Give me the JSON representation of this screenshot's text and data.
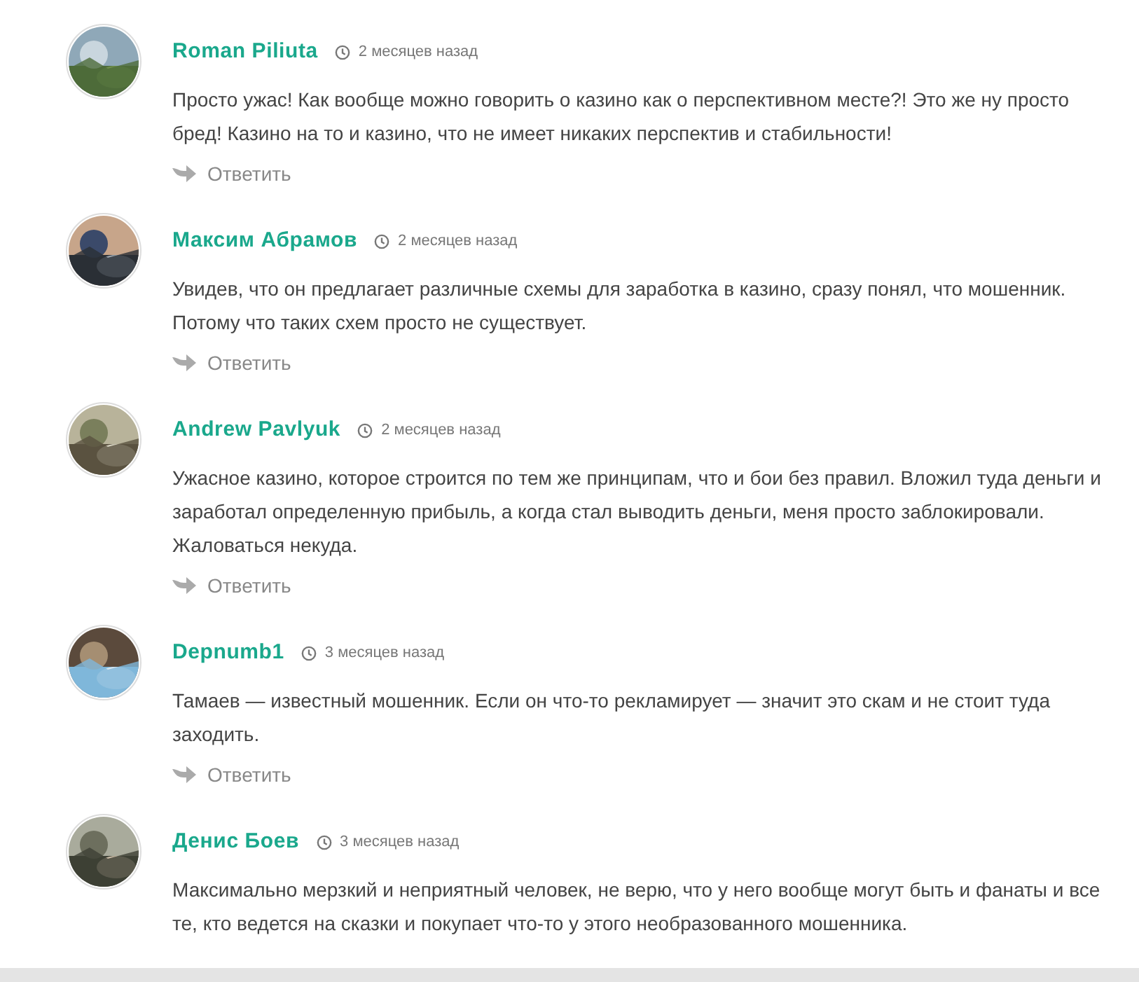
{
  "comments": [
    {
      "author": "Roman Piliuta",
      "time": "2 месяцев назад",
      "text": "Просто ужас! Как вообще можно говорить о казино как о перспективном месте?! Это же ну просто бред! Казино на то и казино, что не имеет никаких перспектив и стабильности!",
      "reply": "Ответить"
    },
    {
      "author": "Максим Абрамов",
      "time": "2 месяцев назад",
      "text": "Увидев, что он предлагает различные схемы для заработка в казино, сразу понял, что мошенник. Потому что таких схем просто не существует.",
      "reply": "Ответить"
    },
    {
      "author": "Andrew Pavlyuk",
      "time": "2 месяцев назад",
      "text": "Ужасное казино, которое строится по тем же принципам, что и бои без правил. Вложил туда деньги и заработал определенную прибыль, а когда стал выводить деньги, меня просто заблокировали. Жаловаться некуда.",
      "reply": "Ответить"
    },
    {
      "author": "Depnumb1",
      "time": "3 месяцев назад",
      "text": "Тамаев — известный мошенник. Если он что-то рекламирует — значит это скам и не стоит туда заходить.",
      "reply": "Ответить"
    },
    {
      "author": "Денис Боев",
      "time": "3 месяцев назад",
      "text": "Максимально мерзкий и неприятный человек, не верю, что у него вообще могут быть и фанаты и все те, кто ведется на сказки и покупает что-то у этого необразованного мошенника."
    }
  ]
}
